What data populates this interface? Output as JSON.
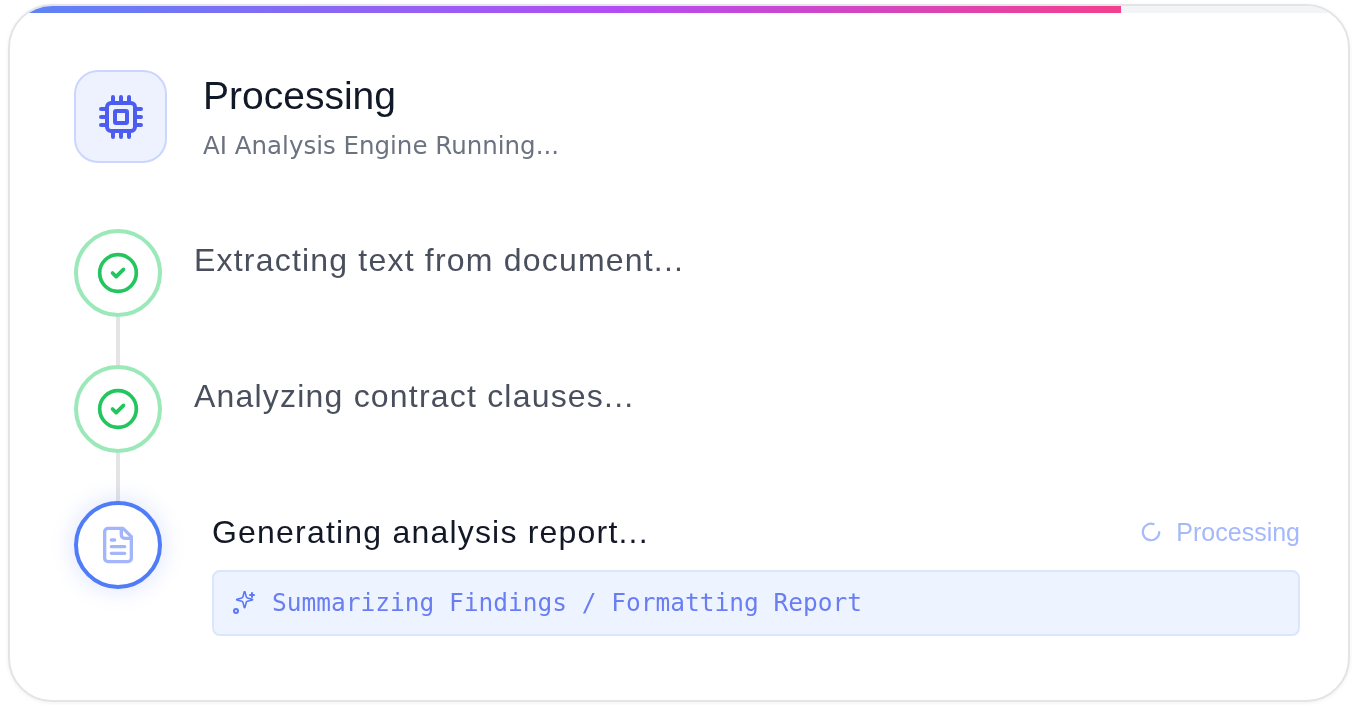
{
  "progress": {
    "level": 0.83
  },
  "header": {
    "title": "Processing",
    "subtitle": "AI Analysis Engine Running..."
  },
  "steps": [
    {
      "kind": "done",
      "label": "Extracting text from document..."
    },
    {
      "kind": "done",
      "label": "Analyzing contract clauses..."
    },
    {
      "kind": "active",
      "label": "Generating analysis report...",
      "status_label": "Processing",
      "detail": "Summarizing Findings / Formatting Report"
    }
  ]
}
